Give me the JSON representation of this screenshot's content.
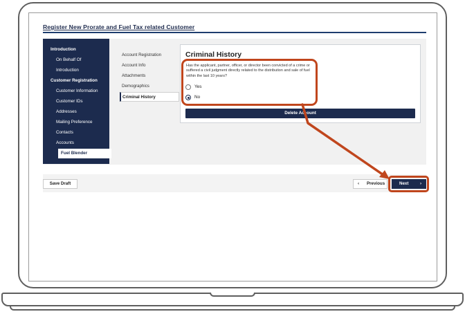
{
  "page": {
    "title": "Register New Prorate and Fuel Tax related Customer"
  },
  "sidebar": {
    "items": [
      {
        "label": "Introduction",
        "type": "head"
      },
      {
        "label": "On Behalf Of",
        "type": "sub"
      },
      {
        "label": "Introduction",
        "type": "sub"
      },
      {
        "label": "Customer Registration",
        "type": "head"
      },
      {
        "label": "Customer Information",
        "type": "sub"
      },
      {
        "label": "Customer IDs",
        "type": "sub"
      },
      {
        "label": "Addresses",
        "type": "sub"
      },
      {
        "label": "Mailing Preference",
        "type": "sub"
      },
      {
        "label": "Contacts",
        "type": "sub"
      },
      {
        "label": "Accounts",
        "type": "sub"
      },
      {
        "label": "Fuel Blender",
        "type": "active"
      }
    ]
  },
  "subnav": {
    "items": [
      {
        "label": "Account Registration"
      },
      {
        "label": "Account Info"
      },
      {
        "label": "Attachments"
      },
      {
        "label": "Demographics"
      },
      {
        "label": "Criminal History",
        "active": true
      }
    ]
  },
  "criminal_history": {
    "title": "Criminal History",
    "question": "Has the applicant, partner, officer, or director been convicted of a crime or suffered a civil judgment directly related to the distribution and sale of fuel within the last 10 years?",
    "options": [
      {
        "label": "Yes",
        "checked": false
      },
      {
        "label": "No",
        "checked": true
      }
    ],
    "delete_label": "Delete Account"
  },
  "footer": {
    "save_draft_label": "Save Draft",
    "previous_label": "Previous",
    "next_label": "Next"
  },
  "colors": {
    "navy": "#1c2b4e",
    "highlight": "#c0461d",
    "panel_bg": "#f1f1f1"
  },
  "icons": {
    "previous": "chevron-left-icon",
    "next": "chevron-right-icon"
  }
}
